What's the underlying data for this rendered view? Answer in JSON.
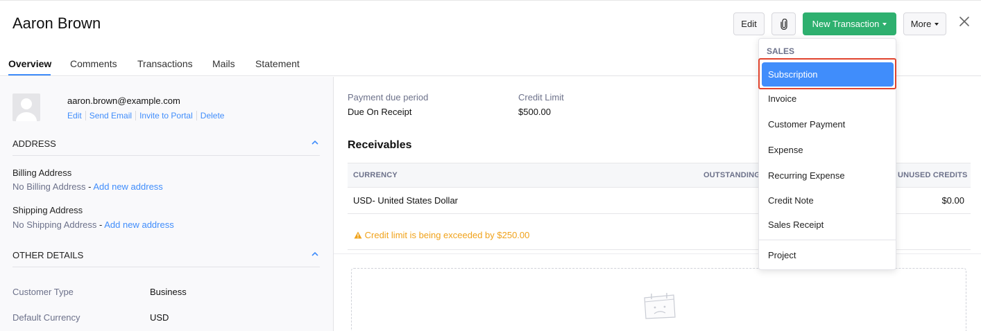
{
  "header": {
    "title": "Aaron Brown",
    "edit_label": "Edit",
    "new_transaction_label": "New Transaction",
    "more_label": "More"
  },
  "tabs": [
    {
      "label": "Overview"
    },
    {
      "label": "Comments"
    },
    {
      "label": "Transactions"
    },
    {
      "label": "Mails"
    },
    {
      "label": "Statement"
    }
  ],
  "contact": {
    "email": "aaron.brown@example.com",
    "links": [
      "Edit",
      "Send Email",
      "Invite to Portal",
      "Delete"
    ]
  },
  "address": {
    "section_title": "ADDRESS",
    "billing_label": "Billing Address",
    "billing_value": "No Billing Address",
    "billing_sep": " - ",
    "billing_link": "Add new address",
    "shipping_label": "Shipping Address",
    "shipping_value": "No Shipping Address",
    "shipping_sep": " - ",
    "shipping_link": "Add new address"
  },
  "other_details": {
    "section_title": "OTHER DETAILS",
    "rows": [
      {
        "label": "Customer Type",
        "value": "Business"
      },
      {
        "label": "Default Currency",
        "value": "USD"
      }
    ]
  },
  "summary": {
    "payment_due_label": "Payment due period",
    "payment_due_value": "Due On Receipt",
    "credit_limit_label": "Credit Limit",
    "credit_limit_value": "$500.00"
  },
  "receivables": {
    "title": "Receivables",
    "columns": [
      "CURRENCY",
      "OUTSTANDING",
      "UNUSED CREDITS"
    ],
    "rows": [
      {
        "currency": "USD- United States Dollar",
        "unused_credits": "$0.00"
      }
    ],
    "warning": "Credit limit is being exceeded by $250.00"
  },
  "dropdown": {
    "section": "SALES",
    "active": "Subscription",
    "items": [
      "Invoice",
      "Customer Payment",
      "Expense",
      "Recurring Expense",
      "Credit Note",
      "Sales Receipt"
    ],
    "footer_item": "Project"
  },
  "colors": {
    "accent": "#408dfb",
    "primary_green": "#2eb06f",
    "warning": "#f0a21a",
    "highlight_border": "#e0432d"
  },
  "icons": [
    "paperclip-icon",
    "caret-down-icon",
    "close-icon",
    "chevron-up-icon",
    "warning-icon",
    "avatar-icon",
    "empty-calendar-icon"
  ]
}
